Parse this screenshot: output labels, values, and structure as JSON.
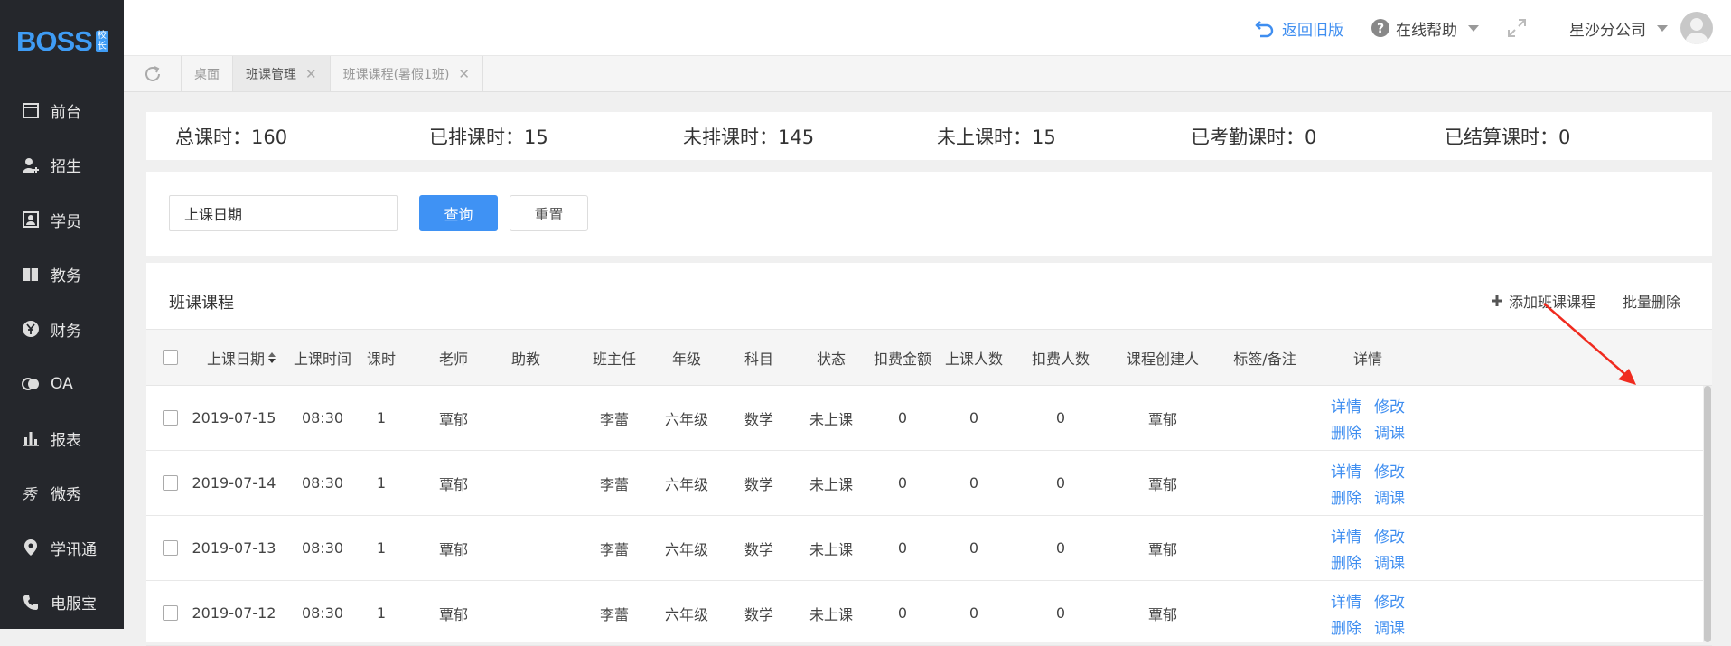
{
  "brand": {
    "logo": "BOSS",
    "badge": [
      "校",
      "长"
    ],
    "accent": "#3f9cf5"
  },
  "sidebar": {
    "items": [
      {
        "label": "前台",
        "icon": "calendar-icon"
      },
      {
        "label": "招生",
        "icon": "user-add-icon"
      },
      {
        "label": "学员",
        "icon": "id-card-icon"
      },
      {
        "label": "教务",
        "icon": "book-icon"
      },
      {
        "label": "财务",
        "icon": "yen-icon"
      },
      {
        "label": "OA",
        "icon": "oa-icon"
      },
      {
        "label": "报表",
        "icon": "bar-chart-icon"
      },
      {
        "label": "微秀",
        "icon": "weixiu-icon"
      },
      {
        "label": "学讯通",
        "icon": "location-icon"
      },
      {
        "label": "电服宝",
        "icon": "phone-icon"
      }
    ]
  },
  "header": {
    "back_label": "返回旧版",
    "help_label": "在线帮助",
    "company": "星沙分公司"
  },
  "tabs": [
    {
      "label": "桌面",
      "closable": false
    },
    {
      "label": "班课管理",
      "closable": true
    },
    {
      "label": "班课课程(暑假1班)",
      "closable": true
    }
  ],
  "stats": [
    "总课时：160",
    "已排课时：15",
    "未排课时：145",
    "未上课时：15",
    "已考勤课时：0",
    "已结算课时：0"
  ],
  "filter": {
    "date_placeholder": "上课日期",
    "query_label": "查询",
    "reset_label": "重置"
  },
  "panel": {
    "title": "班课课程",
    "add_label": "添加班课课程",
    "batch_delete_label": "批量删除"
  },
  "table": {
    "columns": [
      "上课日期",
      "上课时间",
      "课时",
      "老师",
      "助教",
      "班主任",
      "年级",
      "科目",
      "状态",
      "扣费金额",
      "上课人数",
      "扣费人数",
      "课程创建人",
      "标签/备注",
      "详情"
    ],
    "op_labels": [
      "详情",
      "修改",
      "删除",
      "调课"
    ],
    "rows": [
      [
        "2019-07-15",
        "08:30",
        "1",
        "覃郁",
        "",
        "李蕾",
        "六年级",
        "数学",
        "未上课",
        "0",
        "0",
        "0",
        "覃郁",
        ""
      ],
      [
        "2019-07-14",
        "08:30",
        "1",
        "覃郁",
        "",
        "李蕾",
        "六年级",
        "数学",
        "未上课",
        "0",
        "0",
        "0",
        "覃郁",
        ""
      ],
      [
        "2019-07-13",
        "08:30",
        "1",
        "覃郁",
        "",
        "李蕾",
        "六年级",
        "数学",
        "未上课",
        "0",
        "0",
        "0",
        "覃郁",
        ""
      ],
      [
        "2019-07-12",
        "08:30",
        "1",
        "覃郁",
        "",
        "李蕾",
        "六年级",
        "数学",
        "未上课",
        "0",
        "0",
        "0",
        "覃郁",
        ""
      ]
    ]
  },
  "colors": {
    "link": "#3f8ef0",
    "primary": "#3f92f4",
    "sidebar_bg": "#25272c",
    "annotation_arrow": "#f02b1f"
  }
}
